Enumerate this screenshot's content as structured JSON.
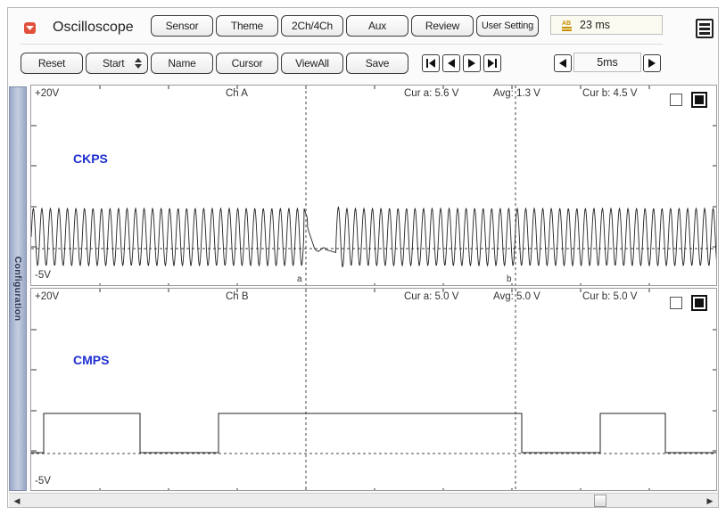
{
  "header": {
    "title": "Oscilloscope",
    "buttons": [
      "Sensor",
      "Theme",
      "2Ch/4Ch",
      "Aux",
      "Review",
      "User Setting"
    ],
    "time_readout": "23 ms"
  },
  "toolbar": {
    "reset": "Reset",
    "start": "Start",
    "name": "Name",
    "cursor": "Cursor",
    "viewall": "ViewAll",
    "save": "Save",
    "timebase": "5ms"
  },
  "sidebar": {
    "label": "Configuration"
  },
  "channels": [
    {
      "name": "Ch A",
      "signal": "CKPS",
      "vmax": "+20V",
      "vmin": "-5V",
      "cur_a": "Cur a: 5.6 V",
      "avg": "Avg: 1.3 V",
      "cur_b": "Cur b: 4.5 V",
      "cursor_a": "a",
      "cursor_b": "b"
    },
    {
      "name": "Ch B",
      "signal": "CMPS",
      "vmax": "+20V",
      "vmin": "-5V",
      "cur_a": "Cur a: 5.0 V",
      "avg": "Avg: 5.0 V",
      "cur_b": "Cur b: 5.0 V"
    }
  ],
  "colors": {
    "signal_label": "#1f2fd0",
    "sidebar": "#b3bdd6",
    "logo": "#e0503a"
  }
}
